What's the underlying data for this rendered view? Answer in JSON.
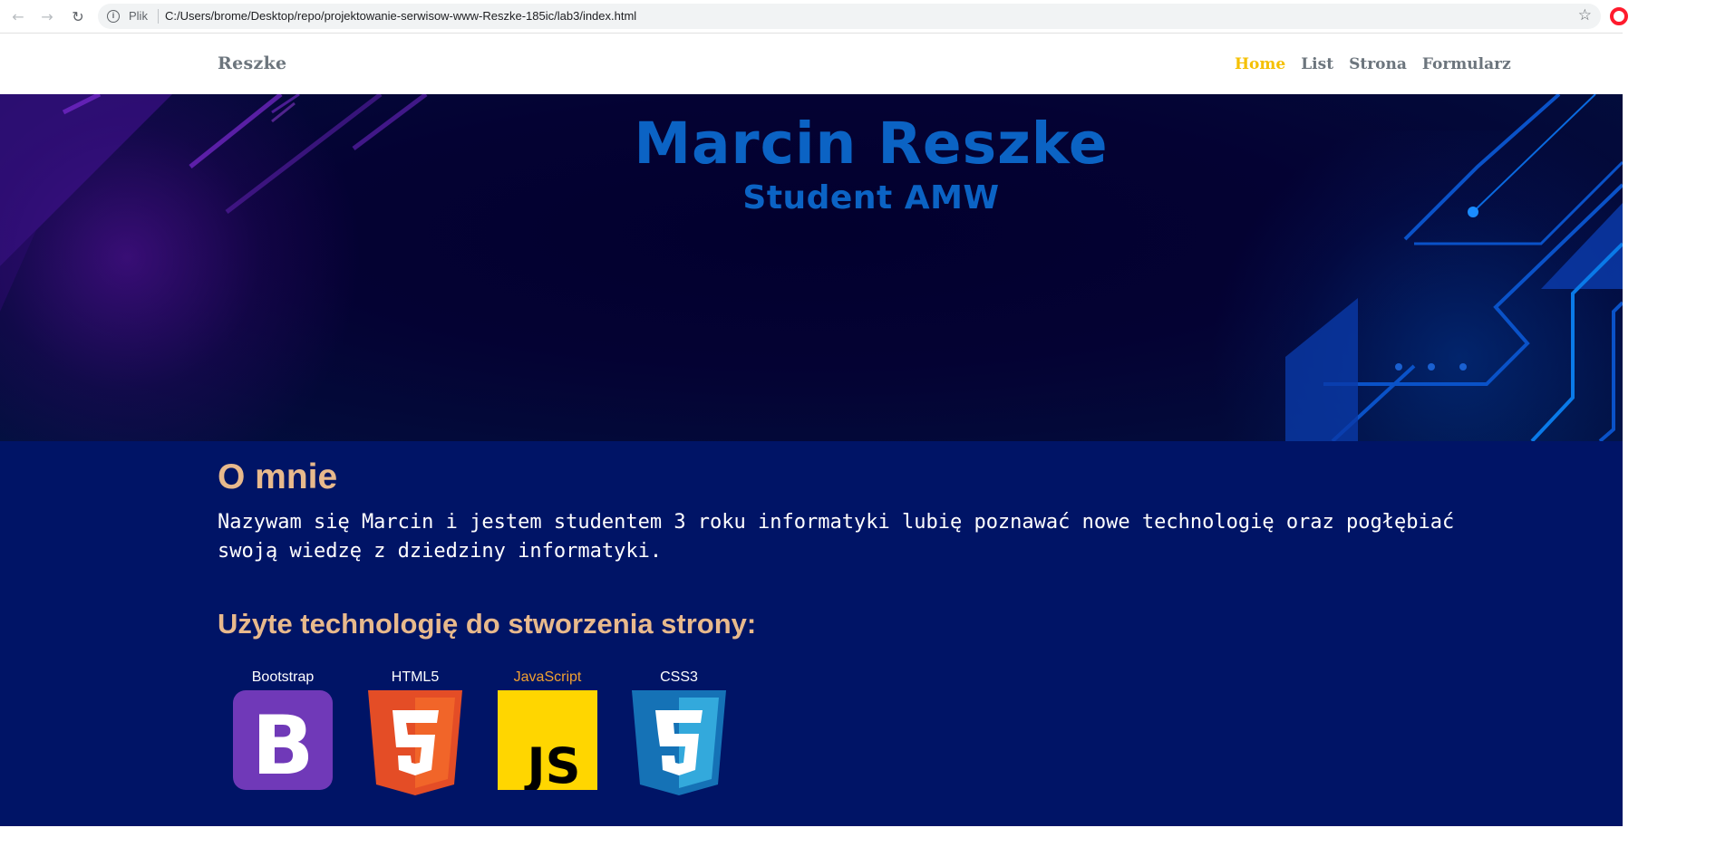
{
  "browser": {
    "scheme_label": "Plik",
    "url": "C:/Users/brome/Desktop/repo/projektowanie-serwisow-www-Reszke-185ic/lab3/index.html",
    "icons": [
      "back-arrow-icon",
      "forward-arrow-icon",
      "reload-icon",
      "info-icon",
      "star-icon",
      "opera-icon"
    ]
  },
  "navbar": {
    "brand": "Reszke",
    "links": [
      {
        "label": "Home",
        "active": true
      },
      {
        "label": "List",
        "active": false
      },
      {
        "label": "Strona",
        "active": false
      },
      {
        "label": "Formularz",
        "active": false
      }
    ]
  },
  "hero": {
    "title": "Marcin Reszke",
    "subtitle": "Student AMW"
  },
  "about": {
    "heading": "O mnie",
    "bio": "Nazywam się Marcin i jestem studentem 3 roku informatyki lubię poznawać nowe technologię oraz pogłębiać swoją wiedzę z dziedziny informatyki.",
    "tech_heading": "Użyte technologię do stworzenia strony:",
    "technologies": [
      {
        "label": "Bootstrap",
        "icon": "bootstrap-logo-icon"
      },
      {
        "label": "HTML5",
        "icon": "html5-logo-icon"
      },
      {
        "label": "JavaScript",
        "icon": "javascript-logo-icon"
      },
      {
        "label": "CSS3",
        "icon": "css3-logo-icon"
      }
    ]
  },
  "colors": {
    "nav_active": "#f5c000",
    "nav_text": "#6c757d",
    "hero_title": "#0b63c4",
    "about_bg": "#001466",
    "heading": "#e8b98c"
  }
}
